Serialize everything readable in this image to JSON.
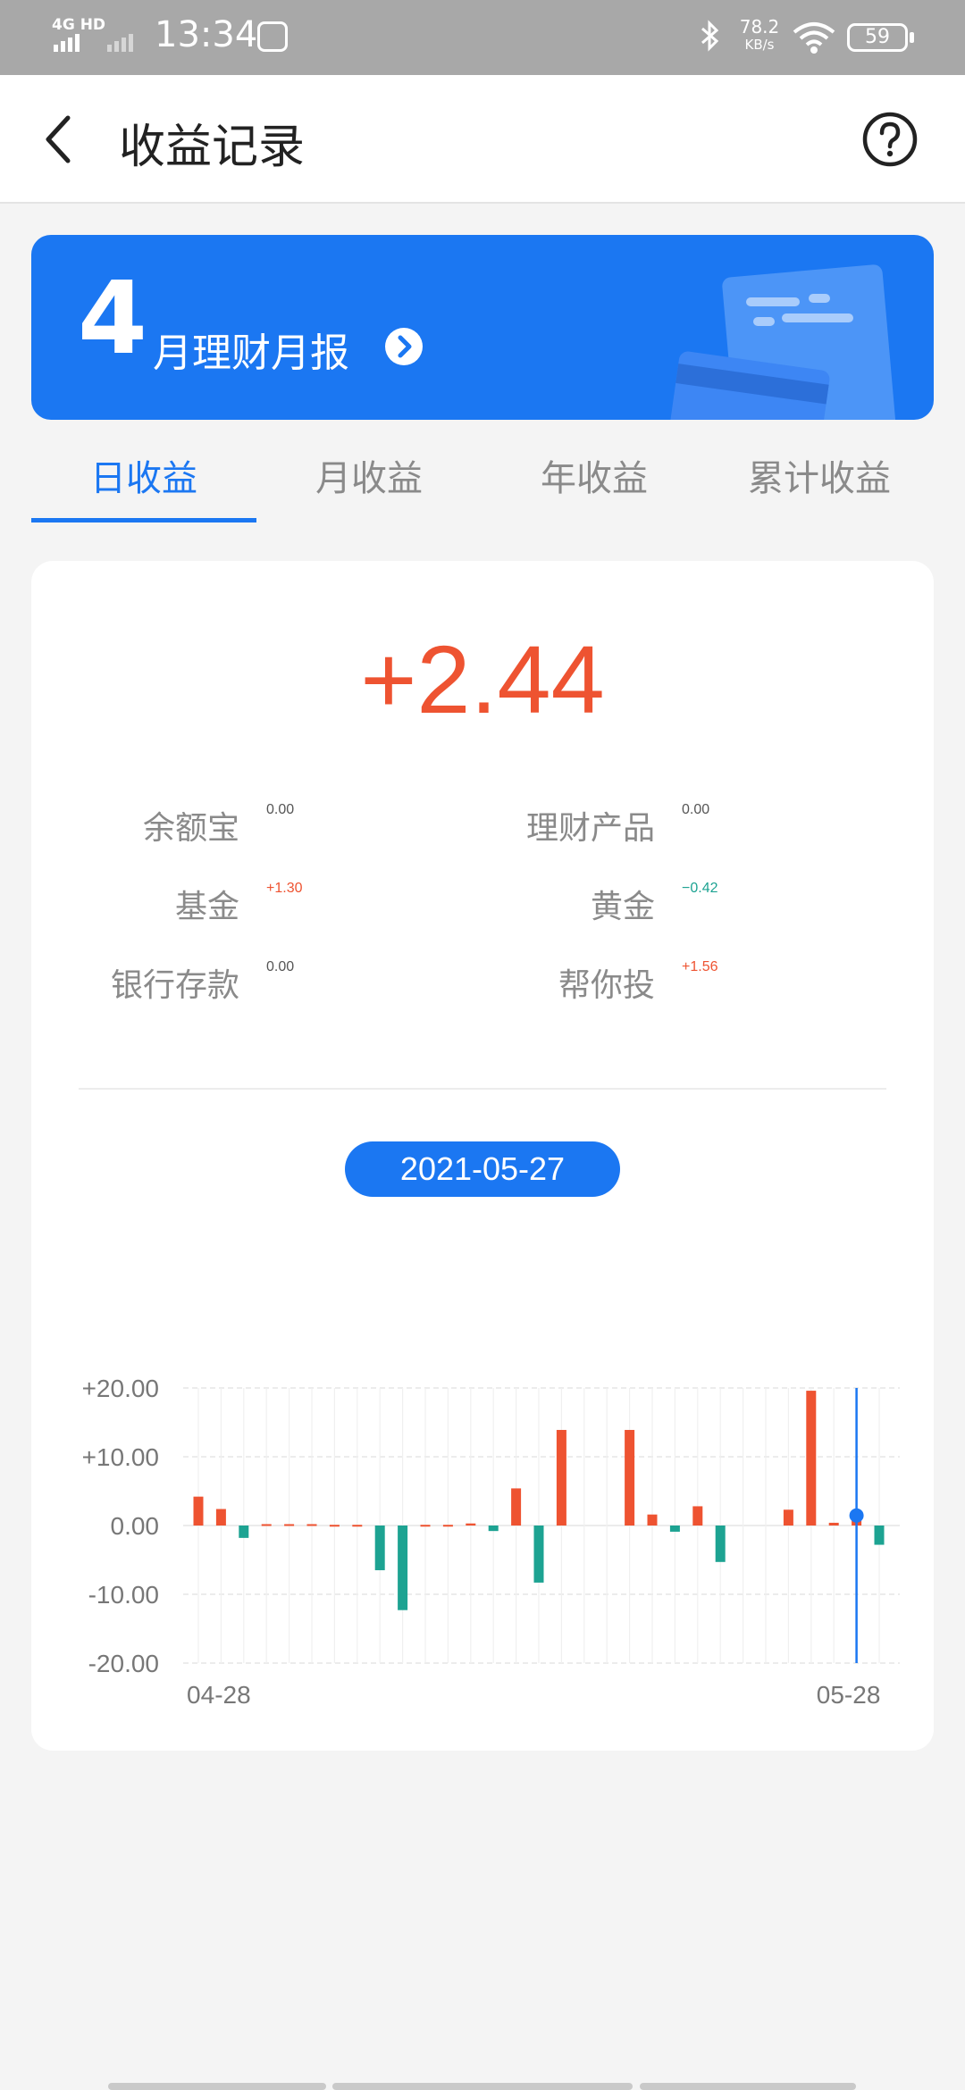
{
  "status_bar": {
    "network": "4G HD",
    "time": "13:34",
    "speed_value": "78.2",
    "speed_unit": "KB/s",
    "battery": "59"
  },
  "header": {
    "title": "收益记录"
  },
  "banner": {
    "month": "4",
    "text": "月理财月报"
  },
  "tabs": [
    {
      "label": "日收益",
      "active": true
    },
    {
      "label": "月收益",
      "active": false
    },
    {
      "label": "年收益",
      "active": false
    },
    {
      "label": "累计收益",
      "active": false
    }
  ],
  "summary": {
    "total": "+2.44",
    "items": [
      {
        "label": "余额宝",
        "value": "0.00",
        "sign": "zero"
      },
      {
        "label": "理财产品",
        "value": "0.00",
        "sign": "zero"
      },
      {
        "label": "基金",
        "value": "+1.30",
        "sign": "pos"
      },
      {
        "label": "黄金",
        "value": "−0.42",
        "sign": "neg"
      },
      {
        "label": "银行存款",
        "value": "0.00",
        "sign": "zero"
      },
      {
        "label": "帮你投",
        "value": "+1.56",
        "sign": "pos"
      }
    ]
  },
  "chart": {
    "selected_date": "2021-05-27"
  },
  "colors": {
    "accent": "#1b77f2",
    "positive": "#ee5331",
    "negative": "#1da392"
  },
  "chart_data": {
    "type": "bar",
    "x_tick_labels": [
      "04-28",
      "05-28"
    ],
    "y_tick_labels": [
      "+20.00",
      "+10.00",
      "0.00",
      "-10.00",
      "-20.00"
    ],
    "ylim": [
      -20,
      20
    ],
    "grid": true,
    "selected_index": 29,
    "values": [
      4.2,
      2.4,
      -1.8,
      0.2,
      0.2,
      0.2,
      0.1,
      0.1,
      -6.5,
      -12.3,
      0.1,
      0.1,
      0.3,
      -0.8,
      5.4,
      -8.3,
      13.9,
      0,
      0,
      13.9,
      1.6,
      -0.9,
      2.8,
      -5.3,
      0,
      0,
      2.3,
      19.6,
      0.4,
      1.2,
      -2.8
    ]
  }
}
